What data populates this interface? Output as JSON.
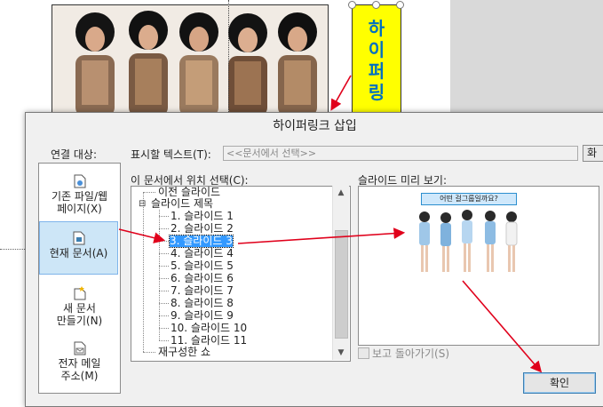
{
  "slide": {
    "sticker_chars": [
      "하",
      "이",
      "퍼",
      "링"
    ]
  },
  "dialog": {
    "title": "하이퍼링크 삽입",
    "link_to_label": "연결 대상:",
    "display_text_label": "표시할 텍스트(T):",
    "display_text_value": "<<문서에서 선택>>",
    "screentip_label": "화",
    "place_label": "이 문서에서 위치 선택(C):",
    "preview_label": "슬라이드 미리 보기:",
    "show_return_label": "보고 돌아가기(S)",
    "ok_label": "확인"
  },
  "link_to": [
    {
      "label_1": "기존 파일/웹",
      "label_2": "페이지(X)"
    },
    {
      "label_1": "현재 문서(A)",
      "label_2": ""
    },
    {
      "label_1": "새 문서",
      "label_2": "만들기(N)"
    },
    {
      "label_1": "전자 메일",
      "label_2": "주소(M)"
    }
  ],
  "tree": {
    "prev": "이전 슬라이드",
    "titles": "슬라이드 제목",
    "slides": [
      "1. 슬라이드 1",
      "2. 슬라이드 2",
      "3. 슬라이드 3",
      "4. 슬라이드 4",
      "5. 슬라이드 5",
      "6. 슬라이드 6",
      "7. 슬라이드 7",
      "8. 슬라이드 8",
      "9. 슬라이드 9",
      "10. 슬라이드 10",
      "11. 슬라이드 11"
    ],
    "custom_shows": "재구성한 쇼",
    "selected_index": 2
  },
  "preview": {
    "caption": "어떤 걸그룹일까요?"
  },
  "colors": {
    "accent_arrow": "#e0001b",
    "selection": "#3399ff",
    "sticker": "#ffff00",
    "sticker_text": "#0070c0"
  }
}
